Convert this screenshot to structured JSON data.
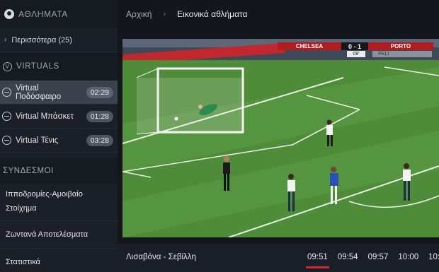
{
  "sidebar": {
    "title": "ΑΘΛΗΜΑΤΑ",
    "more": "Περισσότερα (25)",
    "virtuals_title": "VIRTUALS",
    "items": [
      {
        "label": "Virtual Ποδόσφαιρο",
        "time": "02:29",
        "active": true
      },
      {
        "label": "Virtual Μπάσκετ",
        "time": "01:28",
        "active": false
      },
      {
        "label": "Virtual Τένις",
        "time": "03:28",
        "active": false
      }
    ],
    "links_title": "ΣΥΝΔΕΣΜΟΙ",
    "links": [
      {
        "label": "Ιπποδρομίες-Αμοιβαίο Στοίχημα"
      },
      {
        "label": "Ζωντανά Αποτελέσματα"
      },
      {
        "label": "Στατιστικά"
      }
    ]
  },
  "breadcrumb": {
    "home": "Αρχική",
    "separator": "›",
    "current": "Εικονικά αθλήματα"
  },
  "video": {
    "home_team": "CHELSEA",
    "score": "0 - 1",
    "away_team": "PORTO",
    "clock": "09'",
    "extra_text": "PELI"
  },
  "bottom": {
    "match": "Λισαβόνα - Σεβίλλη",
    "times": [
      "09:51",
      "09:54",
      "09:57",
      "10:00",
      "10:"
    ],
    "selected_index": 0
  },
  "colors": {
    "accent": "#d42a2f",
    "pitch": "#4d8a38",
    "sidebar_bg": "#1b1f27"
  }
}
